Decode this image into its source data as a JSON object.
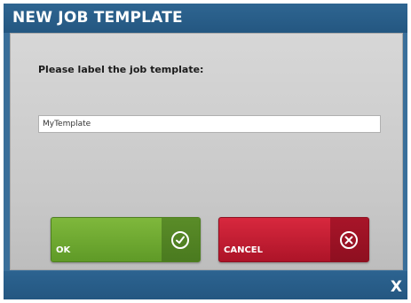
{
  "dialog": {
    "title": "NEW JOB TEMPLATE",
    "prompt": "Please label the job template:",
    "template_name_value": "MyTemplate",
    "ok_label": "OK",
    "cancel_label": "CANCEL",
    "close_label": "X"
  },
  "icons": {
    "ok": "checkmark-circle-icon",
    "cancel": "x-circle-icon",
    "close": "close-icon"
  },
  "colors": {
    "title_bar": "#245781",
    "ok_button": "#6aa630",
    "cancel_button": "#c01c31",
    "content_bg": "#d0d0d0"
  }
}
